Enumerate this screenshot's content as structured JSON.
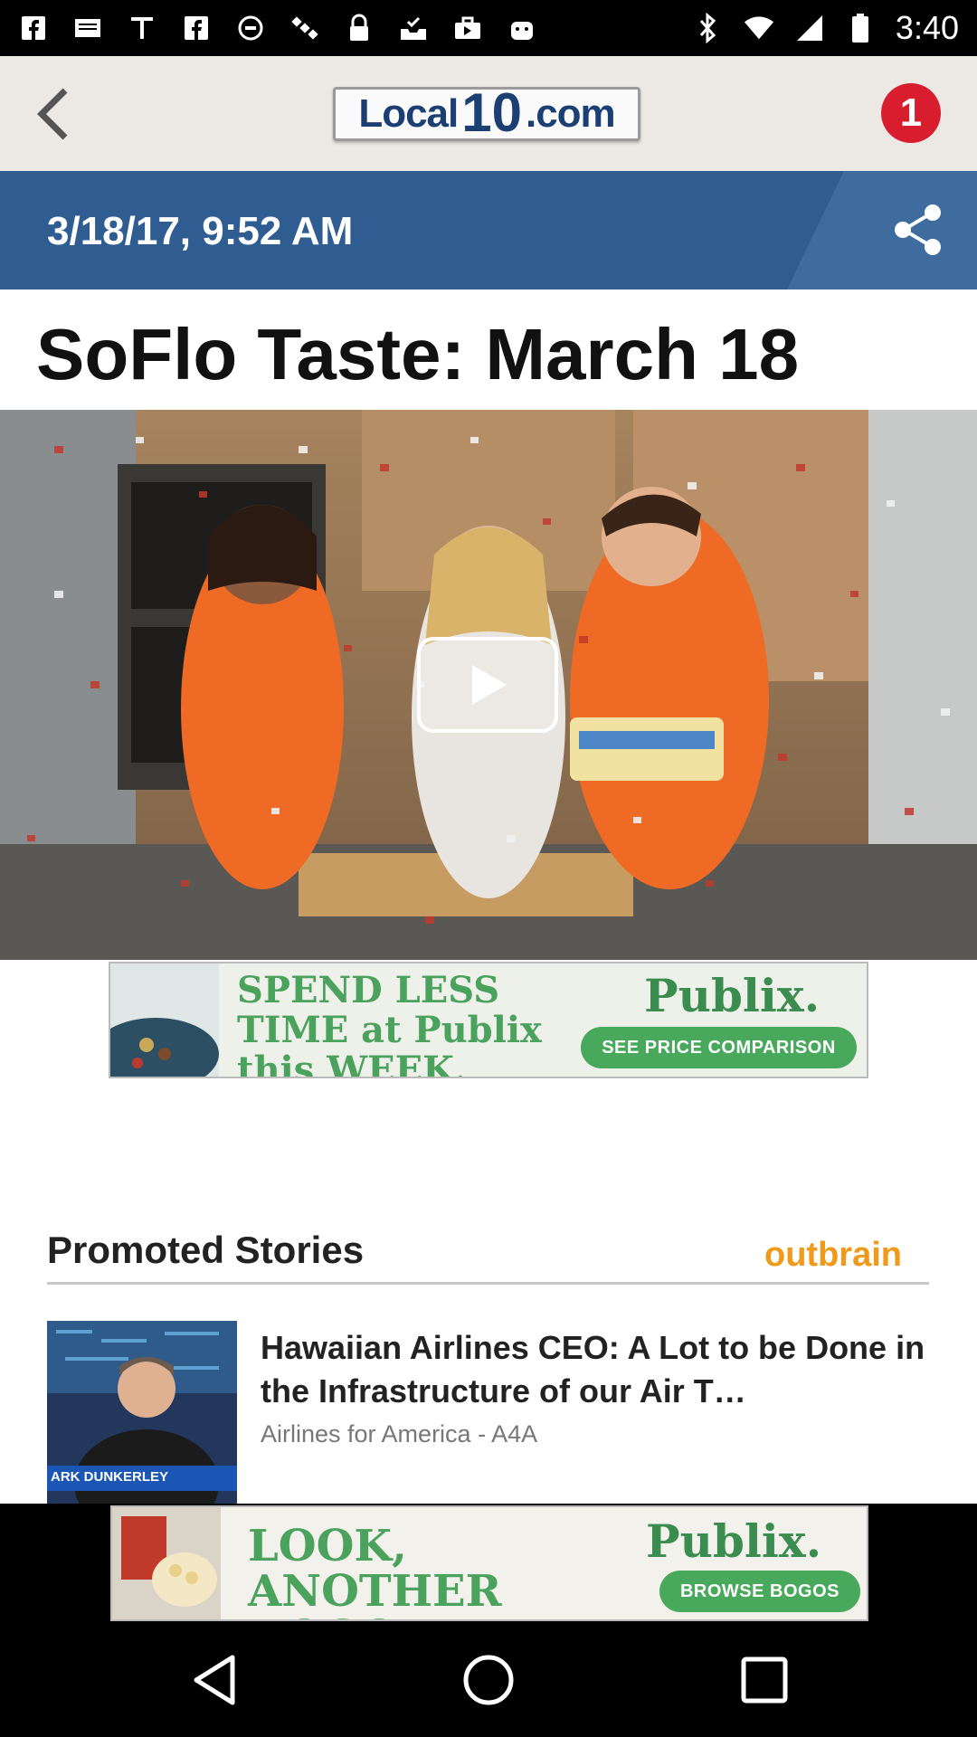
{
  "status_bar": {
    "time": "3:40",
    "left_icons": [
      "facebook-icon",
      "mail-icon",
      "text-icon",
      "facebook-icon",
      "circle-icon",
      "satellite-icon",
      "lock-icon",
      "inbox-icon",
      "briefcase-icon",
      "android-icon"
    ],
    "right_icons": [
      "bluetooth-icon",
      "wifi-icon",
      "signal-icon",
      "battery-icon"
    ]
  },
  "header": {
    "logo_text_left": "Local",
    "logo_number": "10",
    "logo_text_right": ".com",
    "notification_count": "1"
  },
  "article": {
    "date": "3/18/17, 9:52 AM",
    "title": "SoFlo Taste: March 18"
  },
  "ads": {
    "top": {
      "headline": "SPEND LESS TIME at Publix this WEEK.",
      "brand": "Publix.",
      "cta": "SEE PRICE COMPARISON"
    },
    "bottom": {
      "headline": "LOOK, ANOTHER BOGO!",
      "brand": "Publix.",
      "cta": "BROWSE BOGOS"
    }
  },
  "promoted": {
    "heading": "Promoted Stories",
    "provider": "outbrain",
    "stories": [
      {
        "title": "Hawaiian Airlines CEO: A Lot to be Done in the Infrastructure of our Air T…",
        "source": "Airlines for America - A4A",
        "thumb_caption": "ARK DUNKERLEY"
      }
    ]
  },
  "colors": {
    "date_bar": "#2f5d91",
    "notification": "#d81d2e",
    "publix_green": "#48a85b",
    "outbrain_orange": "#f09a1b"
  }
}
